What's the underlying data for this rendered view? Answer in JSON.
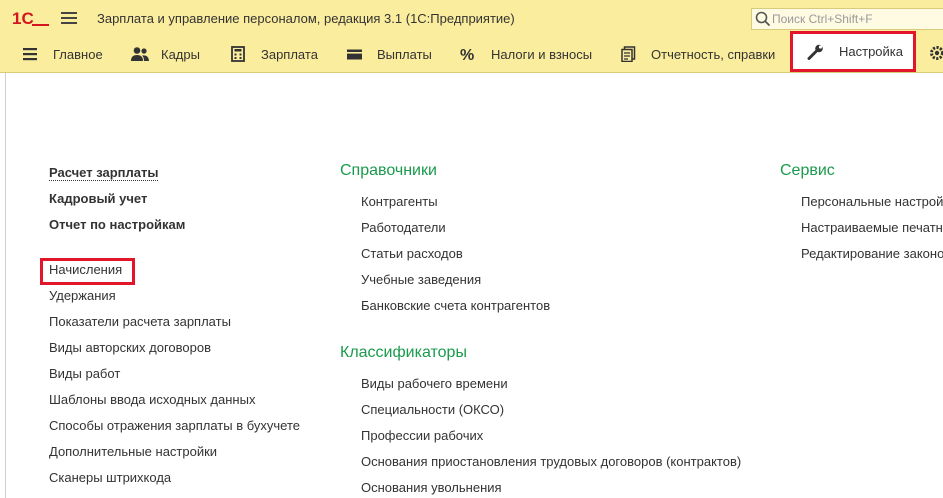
{
  "header": {
    "logo_text": "1С",
    "app_title": "Зарплата и управление персоналом, редакция 3.1  (1С:Предприятие)",
    "search_placeholder": "Поиск Ctrl+Shift+F"
  },
  "sections": [
    {
      "label": "Главное",
      "icon": "menu-lines-icon"
    },
    {
      "label": "Кадры",
      "icon": "people-icon"
    },
    {
      "label": "Зарплата",
      "icon": "calculator-icon"
    },
    {
      "label": "Выплаты",
      "icon": "wallet-icon"
    },
    {
      "label": "Налоги и взносы",
      "icon": "percent-icon"
    },
    {
      "label": "Отчетность, справки",
      "icon": "report-icon"
    },
    {
      "label": "Настройка",
      "icon": "wrench-icon",
      "active": true
    }
  ],
  "accent_color": "#e3152a",
  "heading_color": "#1a9a4c",
  "left_column": {
    "top_links": [
      "Расчет зарплаты",
      "Кадровый учет",
      "Отчет по настройкам"
    ],
    "links": [
      "Начисления",
      "Удержания",
      "Показатели расчета зарплаты",
      "Виды авторских договоров",
      "Виды работ",
      "Шаблоны ввода исходных данных",
      "Способы отражения зарплаты в бухучете",
      "Дополнительные настройки",
      "Сканеры штрихкода"
    ]
  },
  "middle_column": {
    "directories_heading": "Справочники",
    "directories": [
      "Контрагенты",
      "Работодатели",
      "Статьи расходов",
      "Учебные заведения",
      "Банковские счета контрагентов"
    ],
    "classifiers_heading": "Классификаторы",
    "classifiers": [
      "Виды рабочего времени",
      "Специальности (ОКСО)",
      "Профессии рабочих",
      "Основания приостановления трудовых договоров (контрактов)",
      "Основания увольнения"
    ]
  },
  "right_column": {
    "heading": "Сервис",
    "links": [
      "Персональные настрой",
      "Настраиваемые печатн",
      "Редактирование законо"
    ]
  }
}
